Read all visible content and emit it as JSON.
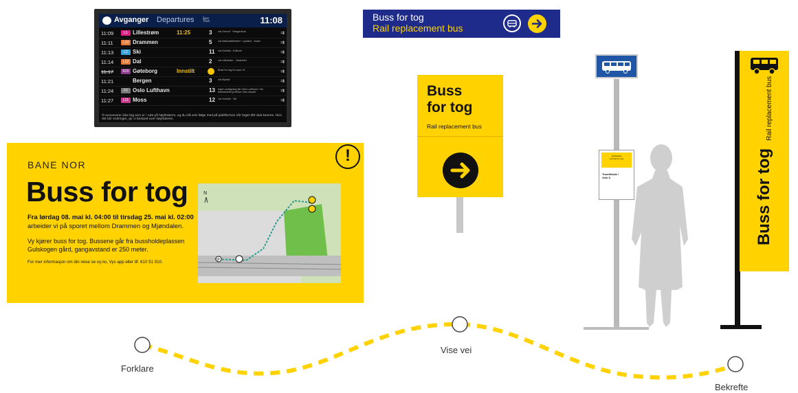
{
  "departure_board": {
    "title_no": "Avganger",
    "title_en": "Departures",
    "track_header": "Spor\nTrack",
    "clock": "11:08",
    "rows": [
      {
        "time": "11:09",
        "line": "L1",
        "line_color": "#e0218a",
        "destination": "Lillestrøm",
        "new_time": "11:25",
        "track": "3",
        "info": "via Grorud · Haugerstua",
        "cancelled": false
      },
      {
        "time": "11:11",
        "line": "L13",
        "line_color": "#e07b39",
        "destination": "Drammen",
        "new_time": "",
        "track": "5",
        "info": "via Nationaltheatret · Lysaker · Asker",
        "cancelled": false
      },
      {
        "time": "11:13",
        "line": "L2",
        "line_color": "#3aa0d8",
        "destination": "Ski",
        "new_time": "",
        "track": "11",
        "info": "via Holmlia · Kolbotn",
        "cancelled": false
      },
      {
        "time": "11:14",
        "line": "L12",
        "line_color": "#e07b39",
        "destination": "Dal",
        "new_time": "",
        "track": "2",
        "info": "via Lillestrøm · Jessheim",
        "cancelled": false
      },
      {
        "time": "11:17",
        "line": "R20",
        "line_color": "#8b3a8b",
        "destination": "Gøteborg",
        "new_time": "Innstilt",
        "track": "bus",
        "info": "Buss for tog fra spor 19",
        "cancelled": true
      },
      {
        "time": "11:21",
        "line": "",
        "line_color": "#000000",
        "destination": "Bergen",
        "new_time": "",
        "track": "3",
        "info": "via Myrdal",
        "cancelled": false
      },
      {
        "time": "11:24",
        "line": "F2",
        "line_color": "#777777",
        "destination": "Oslo Lufthavn",
        "new_time": "",
        "track": "13",
        "info": "Ingen avstigning før Oslo Lufthavn / No disembarking before Oslo Airport",
        "cancelled": false
      },
      {
        "time": "11:27",
        "line": "L21",
        "line_color": "#c53b8a",
        "destination": "Moss",
        "new_time": "",
        "track": "12",
        "info": "via Holmlia · Ski",
        "cancelled": false
      }
    ],
    "footer": "Vi annonserer ikke tog som er i rute på høyttaleren, og du må selv følge med på plattformen når toget ditt skal komme. Hvis det blir endringer, gir vi beskjed over høyttaleren."
  },
  "blue_sign": {
    "line1": "Buss for tog",
    "line2": "Rail replacement bus",
    "icons": [
      "bus-icon",
      "arrow-right-icon"
    ]
  },
  "poster": {
    "brand": "BANE NOR",
    "title": "Buss for tog",
    "para1_bold": "Fra lørdag 08. mai kl. 04:00 til tirsdag 25. mai kl. 02:00",
    "para1_rest": "arbeider vi på sporet mellom Drammen og Mjøndalen.",
    "para2_line1": "Vy kjører buss for tog. Bussene går fra bussholdeplassen",
    "para2_line2": "Gulskogen gård, gangavstand er 250 meter.",
    "para3": "For mer informasjon om din reise se vy.no, Vys app eller tlf. 610 51 910.",
    "warning_symbol": "!"
  },
  "arrow_sign": {
    "title_line1": "Buss",
    "title_line2": "for tog",
    "subtitle": "Rail replacement bus"
  },
  "schedule_poster": {
    "header": "Holdeplass\ned buss for tog",
    "body": "Travellhaste /\nOslo S"
  },
  "banner": {
    "title": "Buss for tog",
    "subtitle": "Rail replacement bus"
  },
  "journey": {
    "stages": [
      "Forklare",
      "Vise vei",
      "Bekrefte"
    ]
  },
  "colors": {
    "yellow": "#ffd200",
    "blue": "#1e2b8a",
    "stop_blue": "#1f57a6"
  }
}
